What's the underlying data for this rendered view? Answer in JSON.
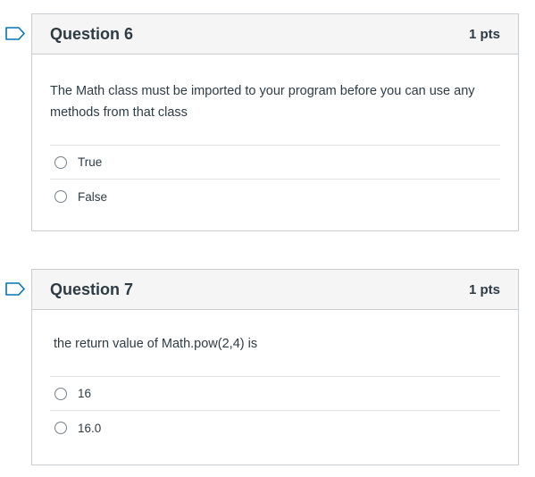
{
  "questions": [
    {
      "title": "Question 6",
      "points": "1 pts",
      "text": "The Math class must be imported to your program before you can use any methods from that class",
      "answers": [
        "True",
        "False"
      ]
    },
    {
      "title": "Question 7",
      "points": "1 pts",
      "text": "the return value of Math.pow(2,4) is",
      "answers": [
        "16",
        "16.0"
      ]
    }
  ],
  "colors": {
    "flag": "#0374b5",
    "header_bg": "#f5f5f5",
    "border": "#c7cdd1",
    "text": "#2d3b45"
  },
  "icons": {
    "flag": "flag-outline-icon",
    "radio": "radio-unchecked-icon"
  }
}
